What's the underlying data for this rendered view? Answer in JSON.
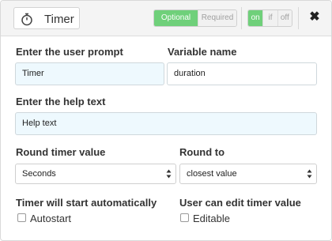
{
  "header": {
    "title": "Timer",
    "requirement": {
      "optional_label": "Optional",
      "required_label": "Required",
      "selected": "Optional"
    },
    "visibility": {
      "on_label": "on",
      "if_label": "if",
      "off_label": "off",
      "selected": "on"
    },
    "close_label": "✖"
  },
  "prompt": {
    "label": "Enter the user prompt",
    "value": "Timer"
  },
  "variable": {
    "label": "Variable name",
    "value": "duration"
  },
  "help": {
    "label": "Enter the help text",
    "value": "Help text"
  },
  "round_value": {
    "label": "Round timer value",
    "selected": "Seconds"
  },
  "round_to": {
    "label": "Round to",
    "selected": "closest value"
  },
  "autostart": {
    "label": "Timer will start automatically",
    "checkbox_label": "Autostart",
    "checked": false
  },
  "editable": {
    "label": "User can edit timer value",
    "checkbox_label": "Editable",
    "checked": false
  },
  "colors": {
    "accent_green": "#6fd07a",
    "input_blue": "#eef9fe"
  }
}
